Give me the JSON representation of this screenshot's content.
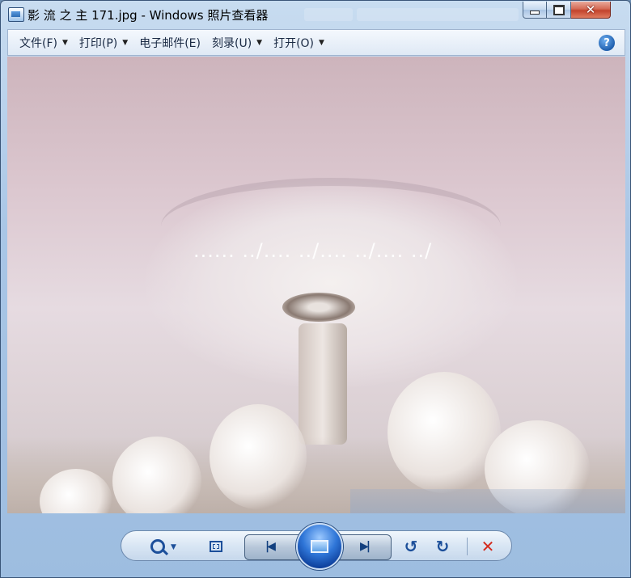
{
  "window": {
    "title": "影 流 之 主 171.jpg - Windows 照片查看器",
    "minimize_label": "",
    "maximize_label": "",
    "close_label": "✕"
  },
  "menu": {
    "items": [
      {
        "label": "文件(F)",
        "has_dropdown": true
      },
      {
        "label": "打印(P)",
        "has_dropdown": true
      },
      {
        "label": "电子邮件(E)",
        "has_dropdown": false
      },
      {
        "label": "刻录(U)",
        "has_dropdown": true
      },
      {
        "label": "打开(O)",
        "has_dropdown": true
      }
    ],
    "dropdown_glyph": "▼",
    "help_glyph": "?"
  },
  "image": {
    "overlay_text": "...... ../.... ../.... ../.... ../"
  },
  "toolbar": {
    "zoom_dropdown_glyph": "▼",
    "prev_glyph": "|◀",
    "next_glyph": "▶|",
    "rotate_ccw_glyph": "↺",
    "rotate_cw_glyph": "↻",
    "delete_glyph": "✕"
  },
  "icons": {
    "app": "photo-viewer-icon",
    "help": "help-icon",
    "zoom": "zoom-icon",
    "fit": "actual-size-icon",
    "prev": "previous-icon",
    "slideshow": "slideshow-icon",
    "next": "next-icon",
    "rotate_ccw": "rotate-ccw-icon",
    "rotate_cw": "rotate-cw-icon",
    "delete": "delete-icon"
  },
  "colors": {
    "delete": "#d42b1e",
    "accent": "#1c4f9a"
  }
}
